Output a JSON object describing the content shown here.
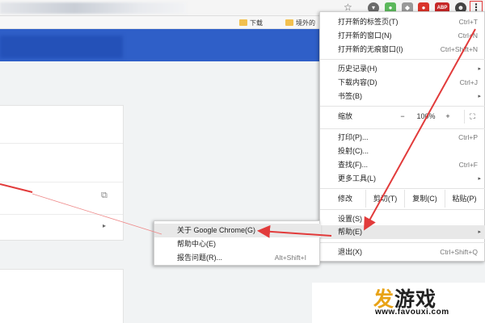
{
  "toolbar": {
    "bookmarks": [
      "下载",
      "境外的"
    ],
    "ext_badge": "ABP",
    "more_icon": "⋮"
  },
  "menu": {
    "items": [
      {
        "label": "打开新的标签页(T)",
        "shortcut": "Ctrl+T"
      },
      {
        "label": "打开新的窗口(N)",
        "shortcut": "Ctrl+N"
      },
      {
        "label": "打开新的无痕窗口(I)",
        "shortcut": "Ctrl+Shift+N"
      },
      {
        "label": "历史记录(H)",
        "shortcut": ""
      },
      {
        "label": "下载内容(D)",
        "shortcut": "Ctrl+J"
      },
      {
        "label": "书签(B)",
        "shortcut": ""
      },
      {
        "label": "打印(P)...",
        "shortcut": "Ctrl+P"
      },
      {
        "label": "投射(C)...",
        "shortcut": ""
      },
      {
        "label": "查找(F)...",
        "shortcut": "Ctrl+F"
      },
      {
        "label": "更多工具(L)",
        "shortcut": ""
      },
      {
        "label": "设置(S)",
        "shortcut": ""
      },
      {
        "label": "帮助(E)",
        "shortcut": ""
      },
      {
        "label": "退出(X)",
        "shortcut": "Ctrl+Shift+Q"
      }
    ],
    "zoom": {
      "label": "缩放",
      "minus": "−",
      "value": "100%",
      "plus": "+",
      "fullscreen": "⛶"
    },
    "edit": {
      "label": "修改",
      "cut": "剪切(T)",
      "copy": "复制(C)",
      "paste": "粘贴(P)"
    }
  },
  "submenu": {
    "items": [
      {
        "label": "关于 Google Chrome(G)",
        "shortcut": ""
      },
      {
        "label": "帮助中心(E)",
        "shortcut": ""
      },
      {
        "label": "报告问题(R)...",
        "shortcut": "Alt+Shift+I"
      }
    ]
  },
  "watermark": {
    "logo_a": "发",
    "logo_b": "游戏",
    "url": "www.favouxi.com"
  },
  "colors": {
    "header_blue": "#2f5fc8",
    "arrow_red": "#e23b3b",
    "menu_highlight": "#e8e8e8"
  }
}
